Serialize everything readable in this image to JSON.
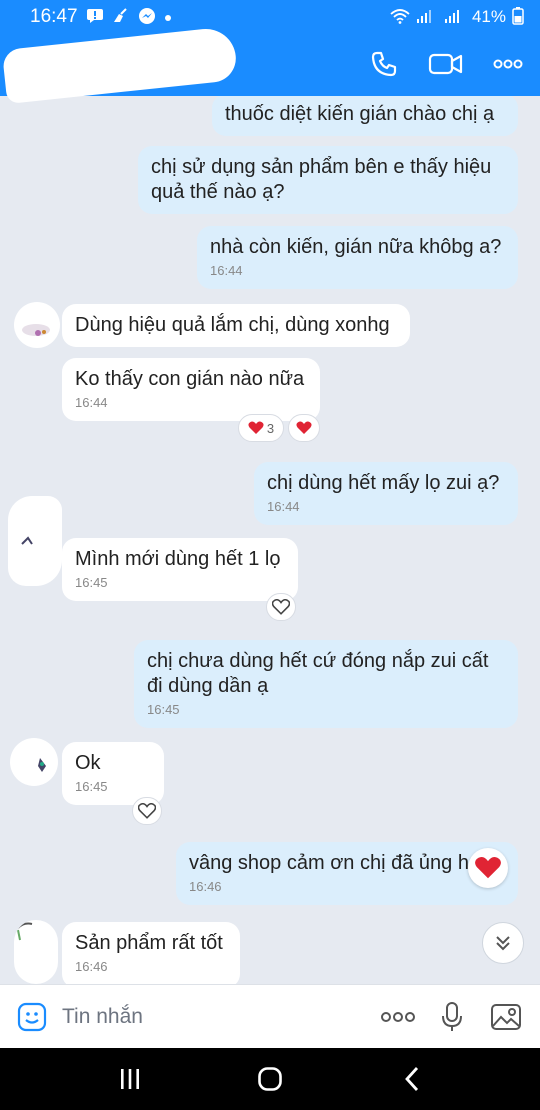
{
  "status_bar": {
    "time": "16:47",
    "battery": "41%"
  },
  "messages": [
    {
      "dir": "out",
      "text": "thuốc diệt kiến gián chào chị ạ"
    },
    {
      "dir": "out",
      "text": "chị sử dụng sản phẩm bên e thấy hiệu quả thế nào ạ?"
    },
    {
      "dir": "out",
      "text": "nhà còn kiến, gián nữa khôbg a?",
      "time": "16:44"
    },
    {
      "dir": "in",
      "text": "Dùng hiệu quả lắm chị, dùng xonhg"
    },
    {
      "dir": "in",
      "text": "Ko thấy con gián nào nữa",
      "time": "16:44",
      "reaction_count": "3"
    },
    {
      "dir": "out",
      "text": "chị dùng hết mấy lọ zui ạ?",
      "time": "16:44"
    },
    {
      "dir": "in",
      "text": "Mình mới dùng hết 1 lọ",
      "time": "16:45"
    },
    {
      "dir": "out",
      "text": "chị chưa dùng hết cứ đóng nắp zui cất đi dùng dần ạ",
      "time": "16:45"
    },
    {
      "dir": "in",
      "text": "Ok",
      "time": "16:45"
    },
    {
      "dir": "out",
      "text": "vâng shop cảm ơn chị đã ủng h",
      "time": "16:46"
    },
    {
      "dir": "in",
      "text": "Sản phẩm rất tốt",
      "time": "16:46"
    }
  ],
  "composer": {
    "placeholder": "Tin nhắn"
  },
  "colors": {
    "header": "#1a8cff",
    "outgoing_bubble": "#dbeefc",
    "incoming_bubble": "#ffffff",
    "chat_background": "#e6eaf1",
    "heart": "#e02434",
    "accent_icon": "#1a8cff"
  },
  "icons": [
    "phone-icon",
    "video-call-icon",
    "more-options-icon",
    "emoji-icon",
    "microphone-icon",
    "gallery-icon",
    "heart-icon",
    "scroll-down-icon"
  ]
}
